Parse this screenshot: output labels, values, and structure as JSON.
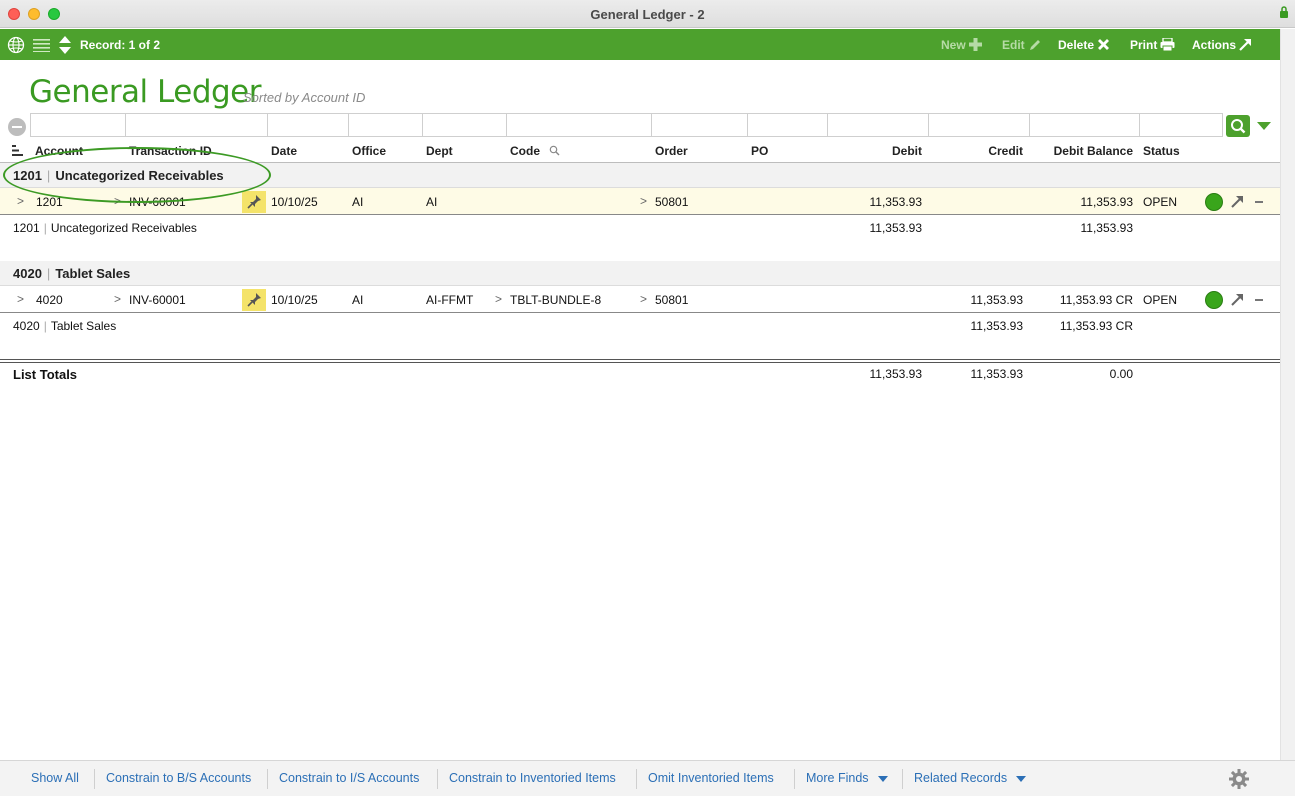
{
  "window": {
    "title": "General Ledger - 2"
  },
  "toolbar": {
    "record_label": "Record: 1 of 2",
    "new_label": "New",
    "edit_label": "Edit",
    "delete_label": "Delete",
    "print_label": "Print",
    "actions_label": "Actions"
  },
  "header": {
    "title": "General Ledger",
    "sort_note": "Sorted by Account ID"
  },
  "columns": {
    "account": "Account",
    "transaction_id": "Transaction ID",
    "date": "Date",
    "office": "Office",
    "dept": "Dept",
    "code": "Code",
    "order": "Order",
    "po": "PO",
    "debit": "Debit",
    "credit": "Credit",
    "debit_balance": "Debit Balance",
    "status": "Status"
  },
  "groups": [
    {
      "account": "1201",
      "name": "Uncategorized Receivables",
      "row": {
        "account": "1201",
        "transaction_id": "INV-60001",
        "date": "10/10/25",
        "office": "AI",
        "dept": "AI",
        "code": "",
        "order": "50801",
        "po": "",
        "debit": "11,353.93",
        "credit": "",
        "debit_balance": "11,353.93",
        "status": "OPEN"
      },
      "subtotal": {
        "account": "1201",
        "name": "Uncategorized Receivables",
        "debit": "11,353.93",
        "credit": "",
        "debit_balance": "11,353.93"
      }
    },
    {
      "account": "4020",
      "name": "Tablet Sales",
      "row": {
        "account": "4020",
        "transaction_id": "INV-60001",
        "date": "10/10/25",
        "office": "AI",
        "dept": "AI-FFMT",
        "code": "TBLT-BUNDLE-8",
        "order": "50801",
        "po": "",
        "debit": "",
        "credit": "11,353.93",
        "debit_balance": "11,353.93 CR",
        "status": "OPEN"
      },
      "subtotal": {
        "account": "4020",
        "name": "Tablet Sales",
        "debit": "",
        "credit": "11,353.93",
        "debit_balance": "11,353.93 CR"
      }
    }
  ],
  "totals": {
    "label": "List Totals",
    "debit": "11,353.93",
    "credit": "11,353.93",
    "debit_balance": "0.00"
  },
  "footer": {
    "links": [
      "Show All",
      "Constrain to B/S Accounts",
      "Constrain to I/S Accounts",
      "Constrain to Inventoried Items",
      "Omit Inventoried Items",
      "More Finds",
      "Related Records"
    ]
  },
  "colors": {
    "accent": "#4da12d",
    "title_green": "#3a9a22",
    "status_open": "#39a51b",
    "link": "#2b6fb6"
  },
  "icons": {
    "toolbar": [
      "globe-icon",
      "list-icon",
      "record-stepper-icon",
      "plus-icon",
      "pencil-icon",
      "x-icon",
      "printer-icon",
      "arrow-out-icon"
    ],
    "rows": [
      "pin-icon",
      "status-dot-icon",
      "jump-icon",
      "minus-icon"
    ],
    "footer": [
      "gear-icon"
    ]
  }
}
